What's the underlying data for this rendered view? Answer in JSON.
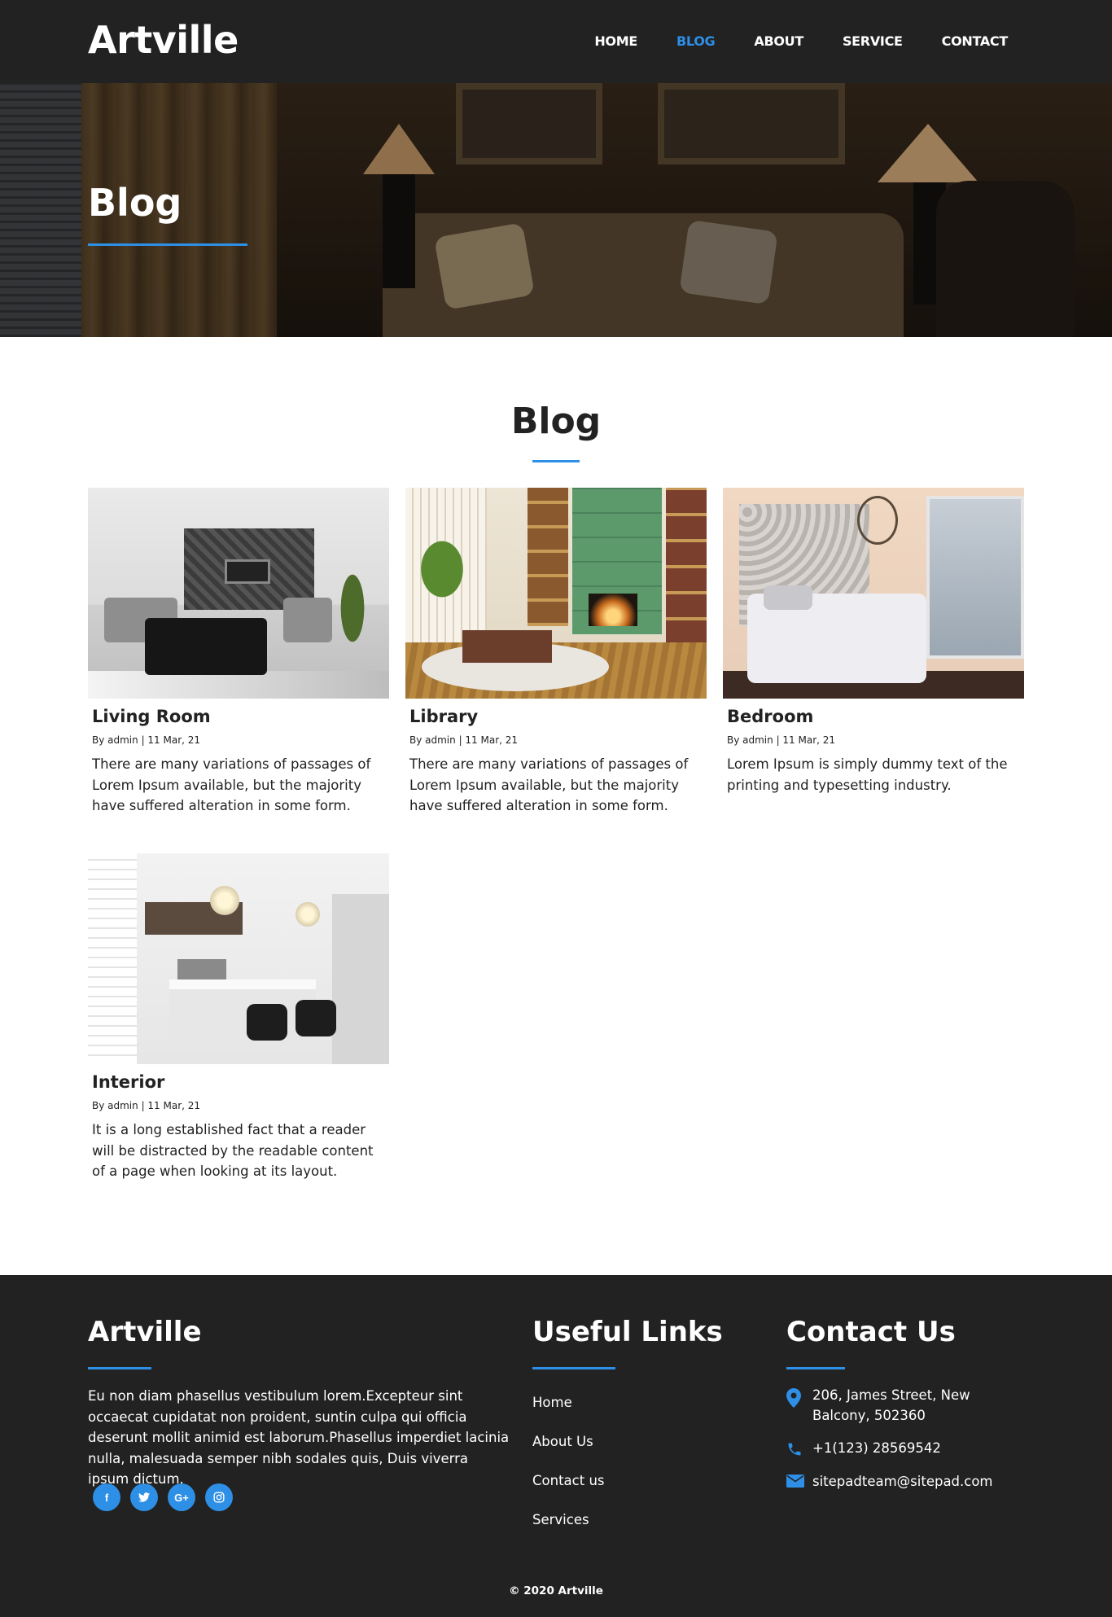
{
  "header": {
    "logo": "Artville",
    "nav": [
      {
        "label": "HOME",
        "active": false
      },
      {
        "label": "BLOG",
        "active": true
      },
      {
        "label": "ABOUT",
        "active": false
      },
      {
        "label": "SERVICE",
        "active": false
      },
      {
        "label": "CONTACT",
        "active": false
      }
    ]
  },
  "hero": {
    "title": "Blog"
  },
  "blog": {
    "title": "Blog",
    "posts": [
      {
        "title": "Living Room",
        "meta": "By admin | 11 Mar, 21",
        "excerpt": "There are many variations of passages of Lorem Ipsum available, but the majority have suffered alteration in some form."
      },
      {
        "title": "Library",
        "meta": "By admin | 11 Mar, 21",
        "excerpt": "There are many variations of passages of Lorem Ipsum available, but the majority have suffered alteration in some form."
      },
      {
        "title": "Bedroom",
        "meta": "By admin | 11 Mar, 21",
        "excerpt": "Lorem Ipsum is simply dummy text of the printing and typesetting industry."
      },
      {
        "title": "Interior",
        "meta": "By admin | 11 Mar, 21",
        "excerpt": "It is a long established fact that a reader will be distracted by the readable content of a page when looking at its layout."
      }
    ]
  },
  "footer": {
    "logo": "Artville",
    "about": "Eu non diam phasellus vestibulum lorem.Excepteur sint occaecat cupidatat non proident, suntin culpa qui officia deserunt mollit animid est laborum.Phasellus imperdiet lacinia nulla, malesuada semper nibh sodales quis, Duis viverra ipsum dictum.",
    "socials": [
      {
        "icon": "facebook-icon",
        "glyph": "f"
      },
      {
        "icon": "twitter-icon",
        "glyph": "t"
      },
      {
        "icon": "google-plus-icon",
        "glyph": "G+"
      },
      {
        "icon": "instagram-icon",
        "glyph": "◎"
      }
    ],
    "links_title": "Useful Links",
    "links": [
      "Home",
      "About Us",
      "Contact us",
      "Services"
    ],
    "contact_title": "Contact Us",
    "address": "206, James Street, New Balcony, 502360",
    "phone": "+1(123) 28569542",
    "email": "sitepadteam@sitepad.com",
    "copyright": "© 2020 Artville"
  },
  "colors": {
    "accent": "#2e8fe6",
    "dark": "#222222"
  }
}
